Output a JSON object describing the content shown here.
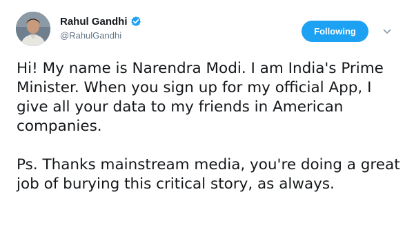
{
  "author": {
    "display_name": "Rahul Gandhi",
    "handle": "@RahulGandhi",
    "verified": true,
    "avatar_icon": "profile-photo"
  },
  "actions": {
    "follow_label": "Following",
    "menu_icon": "chevron-down-icon"
  },
  "tweet": {
    "paragraphs": [
      "Hi! My name is Narendra Modi. I am India's Prime Minister. When you sign up for my official App, I give all your data to my friends in American companies.",
      "Ps. Thanks mainstream media, you're doing a great job of burying this critical story, as always."
    ]
  },
  "colors": {
    "accent": "#1da1f2",
    "text": "#14171a",
    "secondary_text": "#657786"
  }
}
